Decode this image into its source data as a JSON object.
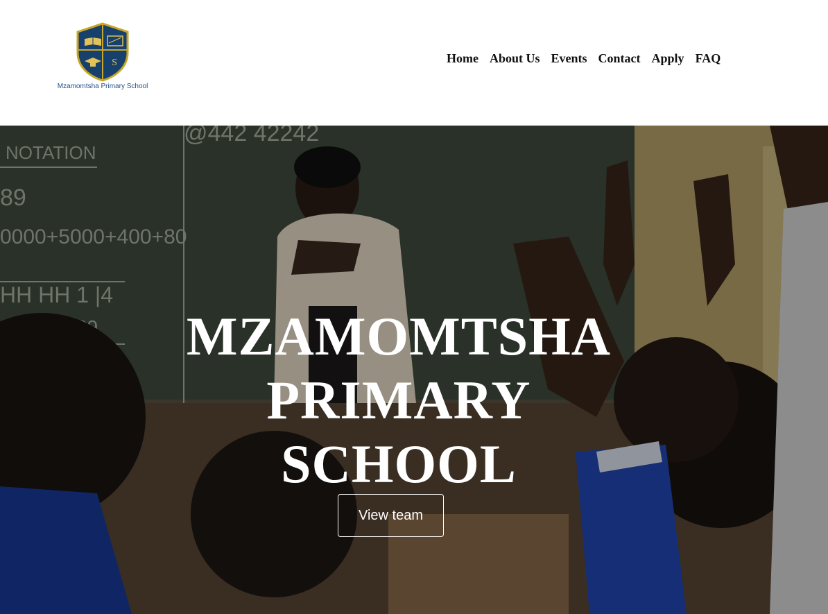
{
  "brand": {
    "logo_caption": "Mzamomtsha Primary School",
    "shield_letter": "S",
    "colors": {
      "shield": "#17406d",
      "trim": "#c8a62a"
    }
  },
  "nav": {
    "items": [
      {
        "label": "Home"
      },
      {
        "label": "About Us"
      },
      {
        "label": "Events"
      },
      {
        "label": "Contact"
      },
      {
        "label": "Apply"
      },
      {
        "label": "FAQ"
      }
    ]
  },
  "hero": {
    "title_lines": [
      "MZAMOMTSHA",
      "PRIMARY",
      "SCHOOL"
    ],
    "button_label": "View team",
    "chalkboard_text": {
      "top": "@442 42242",
      "notation": "NOTATION",
      "digits": "89",
      "expression": "0000+5000+400+80",
      "tally": "HH HH 1 |4",
      "small": "89"
    }
  }
}
